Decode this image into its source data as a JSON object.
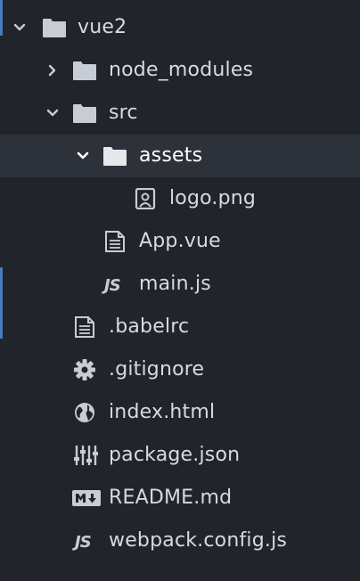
{
  "tree": {
    "items": [
      {
        "label": "vue2",
        "type": "folder",
        "expanded": true,
        "icon": "folder-icon"
      },
      {
        "label": "node_modules",
        "type": "folder",
        "expanded": false,
        "icon": "folder-icon"
      },
      {
        "label": "src",
        "type": "folder",
        "expanded": true,
        "icon": "folder-icon"
      },
      {
        "label": "assets",
        "type": "folder",
        "expanded": true,
        "selected": true,
        "icon": "folder-icon"
      },
      {
        "label": "logo.png",
        "type": "file",
        "icon": "image-file-icon"
      },
      {
        "label": "App.vue",
        "type": "file",
        "icon": "text-file-icon"
      },
      {
        "label": "main.js",
        "type": "file",
        "icon": "js-file-icon",
        "badge": "JS"
      },
      {
        "label": ".babelrc",
        "type": "file",
        "icon": "text-file-icon"
      },
      {
        "label": ".gitignore",
        "type": "file",
        "icon": "gear-icon"
      },
      {
        "label": "index.html",
        "type": "file",
        "icon": "globe-icon"
      },
      {
        "label": "package.json",
        "type": "file",
        "icon": "settings-sliders-icon"
      },
      {
        "label": "README.md",
        "type": "file",
        "icon": "markdown-icon"
      },
      {
        "label": "webpack.config.js",
        "type": "file",
        "icon": "js-file-icon",
        "badge": "JS"
      }
    ]
  },
  "colors": {
    "background": "#21252b",
    "selected_row": "#2c313a",
    "text": "#d7dae0",
    "icon": "#c8ccd4",
    "accent_edge": "#4a78c2"
  }
}
